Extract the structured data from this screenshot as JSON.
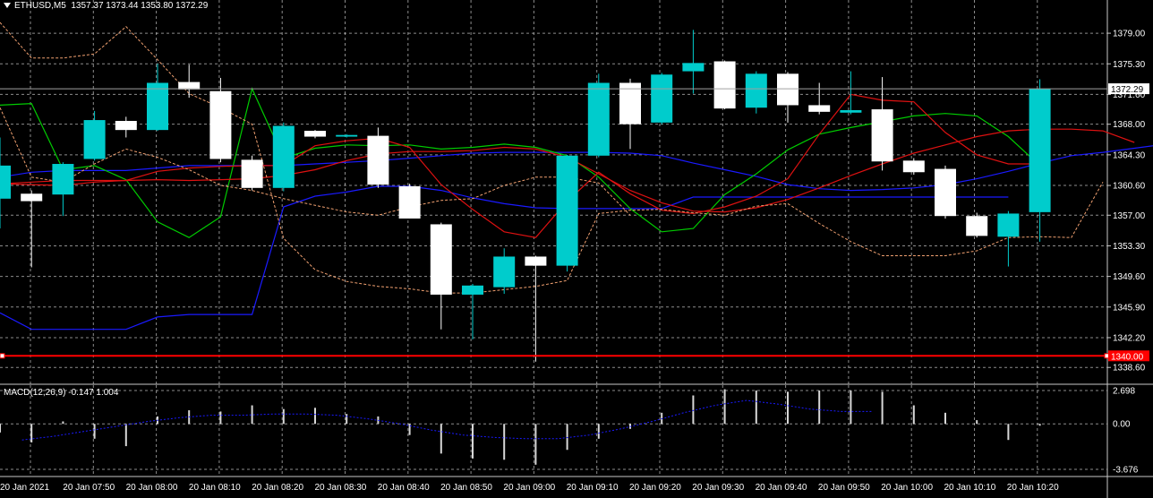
{
  "header": {
    "symbol": "ETHUSD,M5",
    "ohlc": "1357.37 1373.44 1353.80 1372.29"
  },
  "colors": {
    "background": "#000000",
    "grid": "#c8c8c8",
    "bull": "#00cccc",
    "bear": "#ffffff",
    "red_level": "#ff0000",
    "blue_line": "#1a1aff",
    "green_line": "#00cc00",
    "red_line": "#dd1111",
    "orange_line": "#f0a070",
    "macd_signal": "#1a1aff"
  },
  "chart_data": [
    {
      "type": "candlestick",
      "title": "ETHUSD,M5",
      "ylim": [
        1337.0,
        1381.5
      ],
      "y_ticks": [
        "1379.00",
        "1375.30",
        "1371.60",
        "1368.00",
        "1364.30",
        "1360.60",
        "1357.00",
        "1353.30",
        "1349.60",
        "1345.90",
        "1342.20",
        "1338.60"
      ],
      "x_ticks": [
        "20 Jan 2021",
        "20 Jan 07:50",
        "20 Jan 08:00",
        "20 Jan 08:10",
        "20 Jan 08:20",
        "20 Jan 08:30",
        "20 Jan 08:40",
        "20 Jan 08:50",
        "20 Jan 09:00",
        "20 Jan 09:10",
        "20 Jan 09:20",
        "20 Jan 09:30",
        "20 Jan 09:40",
        "20 Jan 09:50",
        "20 Jan 10:00",
        "20 Jan 10:10",
        "20 Jan 10:20"
      ],
      "current_price_label": "1372.29",
      "current_price": 1372.29,
      "level_label": "1340.00",
      "level_price": 1340.0,
      "candles": [
        {
          "o": 1359.0,
          "h": 1366.4,
          "l": 1355.4,
          "c": 1363.0
        },
        {
          "o": 1359.6,
          "h": 1360.0,
          "l": 1350.7,
          "c": 1358.7
        },
        {
          "o": 1359.5,
          "h": 1363.4,
          "l": 1356.9,
          "c": 1363.2
        },
        {
          "o": 1363.8,
          "h": 1369.6,
          "l": 1363.6,
          "c": 1368.5
        },
        {
          "o": 1368.4,
          "h": 1368.9,
          "l": 1366.4,
          "c": 1367.3
        },
        {
          "o": 1367.3,
          "h": 1375.3,
          "l": 1367.2,
          "c": 1373.0
        },
        {
          "o": 1373.1,
          "h": 1375.2,
          "l": 1371.2,
          "c": 1372.2
        },
        {
          "o": 1372.0,
          "h": 1373.6,
          "l": 1363.4,
          "c": 1363.8
        },
        {
          "o": 1363.7,
          "h": 1364.2,
          "l": 1360.0,
          "c": 1360.3
        },
        {
          "o": 1360.3,
          "h": 1368.2,
          "l": 1359.9,
          "c": 1367.8
        },
        {
          "o": 1367.2,
          "h": 1367.3,
          "l": 1366.3,
          "c": 1366.5
        },
        {
          "o": 1366.5,
          "h": 1366.8,
          "l": 1366.4,
          "c": 1366.7
        },
        {
          "o": 1366.6,
          "h": 1367.6,
          "l": 1360.3,
          "c": 1360.7
        },
        {
          "o": 1360.5,
          "h": 1360.8,
          "l": 1356.6,
          "c": 1356.6
        },
        {
          "o": 1355.9,
          "h": 1356.1,
          "l": 1343.2,
          "c": 1347.4
        },
        {
          "o": 1347.4,
          "h": 1348.7,
          "l": 1342.0,
          "c": 1348.5
        },
        {
          "o": 1348.3,
          "h": 1353.0,
          "l": 1347.5,
          "c": 1352.0
        },
        {
          "o": 1352.0,
          "h": 1352.1,
          "l": 1339.3,
          "c": 1350.9
        },
        {
          "o": 1350.9,
          "h": 1364.3,
          "l": 1350.2,
          "c": 1364.2
        },
        {
          "o": 1364.2,
          "h": 1374.1,
          "l": 1364.0,
          "c": 1373.0
        },
        {
          "o": 1373.0,
          "h": 1373.5,
          "l": 1365.0,
          "c": 1368.0
        },
        {
          "o": 1368.2,
          "h": 1374.2,
          "l": 1368.0,
          "c": 1374.0
        },
        {
          "o": 1374.4,
          "h": 1379.4,
          "l": 1371.7,
          "c": 1375.4
        },
        {
          "o": 1375.6,
          "h": 1375.7,
          "l": 1369.8,
          "c": 1369.9
        },
        {
          "o": 1370.0,
          "h": 1374.4,
          "l": 1369.3,
          "c": 1374.1
        },
        {
          "o": 1374.1,
          "h": 1374.3,
          "l": 1368.2,
          "c": 1370.3
        },
        {
          "o": 1370.3,
          "h": 1373.0,
          "l": 1369.2,
          "c": 1369.5
        },
        {
          "o": 1369.4,
          "h": 1374.4,
          "l": 1369.2,
          "c": 1369.7
        },
        {
          "o": 1369.8,
          "h": 1373.7,
          "l": 1362.4,
          "c": 1363.5
        },
        {
          "o": 1363.6,
          "h": 1363.9,
          "l": 1361.9,
          "c": 1362.2
        },
        {
          "o": 1362.6,
          "h": 1363.0,
          "l": 1356.6,
          "c": 1356.9
        },
        {
          "o": 1356.9,
          "h": 1357.3,
          "l": 1354.3,
          "c": 1354.5
        },
        {
          "o": 1354.4,
          "h": 1357.5,
          "l": 1350.8,
          "c": 1357.2
        },
        {
          "o": 1357.37,
          "h": 1373.44,
          "l": 1353.8,
          "c": 1372.29
        }
      ],
      "lines": [
        {
          "color": "blue_line",
          "values": [
            1345.2,
            1343.2,
            1343.2,
            1343.2,
            1343.2,
            1344.7,
            1345.0,
            1345.0,
            1345.0,
            1358.0,
            1359.3,
            1359.8,
            1360.5,
            1360.5,
            1360.0,
            1359.1,
            1358.4,
            1357.9,
            1357.8,
            1357.8,
            1357.8,
            1357.8,
            1359.2,
            1359.2,
            1359.2,
            1359.2,
            1359.2,
            1359.2,
            1359.2,
            1359.2,
            1359.2,
            1359.2,
            1359.2
          ]
        },
        {
          "color": "blue_line",
          "values": [
            1361.6,
            1362.2,
            1362.4,
            1362.4,
            1362.4,
            1362.7,
            1363.0,
            1363.0,
            1363.0,
            1363.0,
            1363.2,
            1363.4,
            1363.6,
            1363.9,
            1364.2,
            1364.5,
            1364.6,
            1364.6,
            1364.6,
            1364.6,
            1364.5,
            1364.2,
            1363.3,
            1362.5,
            1361.7,
            1360.7,
            1360.2,
            1360.0,
            1360.1,
            1360.3,
            1360.7,
            1361.4,
            1362.3,
            1363.3,
            1364.2,
            1364.6,
            1365.1,
            1365.6
          ]
        },
        {
          "color": "green_line",
          "values": [
            1370.3,
            1370.5,
            1362.5,
            1363.0,
            1361.3,
            1356.2,
            1354.3,
            1356.8,
            1372.3,
            1363.9,
            1365.1,
            1365.5,
            1365.4,
            1365.5,
            1365.0,
            1365.2,
            1365.6,
            1365.2,
            1364.2,
            1361.6,
            1357.8,
            1355.0,
            1355.4,
            1359.5,
            1362.0,
            1364.9,
            1366.8,
            1367.6,
            1368.3,
            1369.0,
            1369.3,
            1369.0,
            1366.5,
            1363.0
          ]
        },
        {
          "color": "red_line",
          "values": [
            1360.8,
            1361.0,
            1361.2,
            1361.2,
            1361.2,
            1362.3,
            1362.7,
            1362.9,
            1363.0,
            1363.0,
            1365.4,
            1366.0,
            1366.3,
            1365.2,
            1360.7,
            1357.7,
            1355.0,
            1354.3,
            1358.7,
            1362.2,
            1359.6,
            1357.6,
            1357.2,
            1358.0,
            1359.3,
            1361.4,
            1366.8,
            1371.6,
            1370.9,
            1370.7,
            1367.0,
            1364.3,
            1363.2,
            1363.2
          ]
        },
        {
          "color": "red_line",
          "values": [
            1360.8,
            1360.7,
            1360.6,
            1361.0,
            1361.2,
            1361.3,
            1361.2,
            1361.3,
            1361.4,
            1361.8,
            1362.5,
            1363.6,
            1364.4,
            1364.7,
            1364.7,
            1364.8,
            1365.2,
            1365.0,
            1364.0,
            1362.0,
            1360.0,
            1358.5,
            1357.5,
            1357.4,
            1357.9,
            1358.9,
            1360.3,
            1361.8,
            1363.2,
            1364.5,
            1365.5,
            1366.5,
            1367.2,
            1367.4,
            1367.4,
            1367.2,
            1365.8
          ]
        },
        {
          "color": "orange_line",
          "dashed": true,
          "values": [
            1380.3,
            1376.0,
            1376.0,
            1376.5,
            1379.8,
            1375.8,
            1371.7,
            1370.0,
            1368.0,
            1354.2,
            1350.4,
            1349.0,
            1348.4,
            1348.1,
            1347.6,
            1347.6,
            1348.0,
            1348.4,
            1349.1,
            1357.2,
            1357.6,
            1357.7,
            1357.3,
            1357.0,
            1358.1,
            1358.4,
            1356.0,
            1353.8,
            1352.1,
            1352.1,
            1352.1,
            1352.7,
            1354.3,
            1354.4,
            1354.3,
            1361.0
          ]
        },
        {
          "color": "orange_line",
          "dashed": true,
          "values": [
            1370.0,
            1361.6,
            1361.0,
            1363.2,
            1365.0,
            1364.0,
            1362.5,
            1360.6,
            1360.0,
            1359.0,
            1358.2,
            1357.4,
            1357.0,
            1358.0,
            1358.8,
            1359.0,
            1360.6,
            1361.6,
            1361.6,
            1360.9,
            1357.0
          ]
        }
      ]
    },
    {
      "type": "bar",
      "title": "MACD(12,26,9) -0.147 1.004",
      "ylim": [
        -3.676,
        2.698
      ],
      "y_ticks": [
        "2.698",
        "0.00",
        "-3.676"
      ],
      "macd": [
        -0.7,
        -1.5,
        0.2,
        -1.2,
        -1.8,
        0.6,
        1.1,
        1.0,
        1.5,
        1.2,
        1.3,
        0.8,
        0.6,
        -0.9,
        -2.4,
        -2.8,
        -2.9,
        -3.3,
        -2.1,
        -1.2,
        -0.4,
        0.9,
        2.3,
        2.8,
        2.7,
        2.6,
        2.7,
        2.7,
        2.6,
        1.5,
        0.9,
        0.3,
        -1.3,
        -0.147
      ],
      "signal": [
        -1.3,
        -1.0,
        -0.6,
        -0.2,
        0.2,
        0.5,
        0.7,
        0.7,
        0.8,
        0.8,
        0.7,
        0.4,
        0.0,
        -0.5,
        -0.9,
        -1.1,
        -1.2,
        -1.2,
        -0.9,
        -0.4,
        0.2,
        0.9,
        1.5,
        1.9,
        1.6,
        1.2,
        1.0,
        1.004
      ]
    }
  ]
}
